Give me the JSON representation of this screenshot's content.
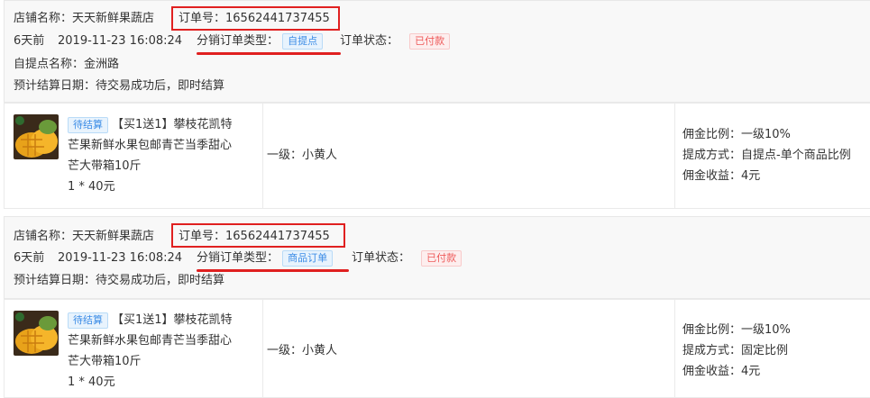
{
  "orders": [
    {
      "shop_label": "店铺名称：",
      "shop_name": "天天新鲜果蔬店",
      "order_no_label": "订单号：",
      "order_no": "16562441737455",
      "time_ago": "6天前",
      "datetime": "2019-11-23 16:08:24",
      "dist_type_label": "分销订单类型：",
      "dist_type": "自提点",
      "status_label": "订单状态：",
      "status": "已付款",
      "pickup_label": "自提点名称：",
      "pickup_name": "金洲路",
      "settle_label": "预计结算日期：",
      "settle_value": "待交易成功后，即时结算",
      "product": {
        "badge": "待结算",
        "title": "【买1送1】攀枝花凯特芒果新鲜水果包邮青芒当季甜心芒大带箱10斤",
        "title_lines": [
          "【买1送1】攀枝花凯特",
          "芒果新鲜水果包邮青芒当季甜心",
          "芒大带箱10斤"
        ],
        "qty_price": "1 * 40元",
        "level": "一级：小黄人",
        "commission_rate_label": "佣金比例：",
        "commission_rate": "一级10%",
        "method_label": "提成方式：",
        "method": "自提点-单个商品比例",
        "income_label": "佣金收益：",
        "income": "4元"
      }
    },
    {
      "shop_label": "店铺名称：",
      "shop_name": "天天新鲜果蔬店",
      "order_no_label": "订单号：",
      "order_no": "16562441737455",
      "time_ago": "6天前",
      "datetime": "2019-11-23 16:08:24",
      "dist_type_label": "分销订单类型：",
      "dist_type": "商品订单",
      "status_label": "订单状态：",
      "status": "已付款",
      "settle_label": "预计结算日期：",
      "settle_value": "待交易成功后，即时结算",
      "product": {
        "badge": "待结算",
        "title": "【买1送1】攀枝花凯特芒果新鲜水果包邮青芒当季甜心芒大带箱10斤",
        "title_lines": [
          "【买1送1】攀枝花凯特",
          "芒果新鲜水果包邮青芒当季甜心",
          "芒大带箱10斤"
        ],
        "qty_price": "1 * 40元",
        "level": "一级：小黄人",
        "commission_rate_label": "佣金比例：",
        "commission_rate": "一级10%",
        "method_label": "提成方式：",
        "method": "固定比例",
        "income_label": "佣金收益：",
        "income": "4元"
      }
    }
  ],
  "colors": {
    "annotation_red": "#e02020",
    "tag_blue": "#3b8ce6",
    "tag_red": "#ee5a5a",
    "header_bg": "#f8f8f8"
  }
}
